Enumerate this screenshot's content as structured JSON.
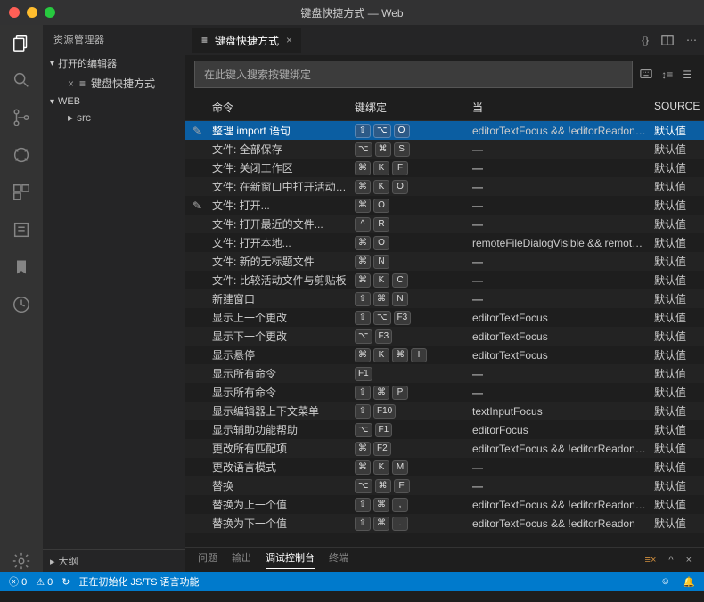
{
  "title": "键盘快捷方式 — Web",
  "sidebar": {
    "title": "资源管理器",
    "open_editors": "打开的编辑器",
    "open_item": "键盘快捷方式",
    "workspace": "WEB",
    "tree": [
      "src"
    ],
    "outline": "大纲"
  },
  "tab": {
    "icon": "≡",
    "label": "键盘快捷方式"
  },
  "search_placeholder": "在此键入搜索按键绑定",
  "columns": {
    "command": "命令",
    "keybinding": "键绑定",
    "when": "当",
    "source": "SOURCE"
  },
  "rows": [
    {
      "cmd": "整理 import 语句",
      "keys": [
        "⇧",
        "⌥",
        "O"
      ],
      "when": "editorTextFocus && !editorReadon…",
      "src": "默认值",
      "selected": true,
      "pencil": true
    },
    {
      "cmd": "文件: 全部保存",
      "keys": [
        "⌥",
        "⌘",
        "S"
      ],
      "when": "—",
      "src": "默认值"
    },
    {
      "cmd": "文件: 关闭工作区",
      "keys": [
        "⌘",
        "K",
        "F"
      ],
      "when": "—",
      "src": "默认值"
    },
    {
      "cmd": "文件: 在新窗口中打开活动文...",
      "keys": [
        "⌘",
        "K",
        "O"
      ],
      "when": "—",
      "src": "默认值"
    },
    {
      "cmd": "文件: 打开...",
      "keys": [
        "⌘",
        "O"
      ],
      "when": "—",
      "src": "默认值",
      "pencil": true
    },
    {
      "cmd": "文件: 打开最近的文件...",
      "keys": [
        "^",
        "R"
      ],
      "when": "—",
      "src": "默认值"
    },
    {
      "cmd": "文件: 打开本地...",
      "keys": [
        "⌘",
        "O"
      ],
      "when": "remoteFileDialogVisible && remot…",
      "src": "默认值"
    },
    {
      "cmd": "文件: 新的无标题文件",
      "keys": [
        "⌘",
        "N"
      ],
      "when": "—",
      "src": "默认值"
    },
    {
      "cmd": "文件: 比较活动文件与剪贴板",
      "keys": [
        "⌘",
        "K",
        "C"
      ],
      "when": "—",
      "src": "默认值"
    },
    {
      "cmd": "新建窗口",
      "keys": [
        "⇧",
        "⌘",
        "N"
      ],
      "when": "—",
      "src": "默认值"
    },
    {
      "cmd": "显示上一个更改",
      "keys": [
        "⇧",
        "⌥",
        "F3"
      ],
      "when": "editorTextFocus",
      "src": "默认值"
    },
    {
      "cmd": "显示下一个更改",
      "keys": [
        "⌥",
        "F3"
      ],
      "when": "editorTextFocus",
      "src": "默认值"
    },
    {
      "cmd": "显示悬停",
      "keys": [
        "⌘",
        "K",
        "⌘",
        "I"
      ],
      "when": "editorTextFocus",
      "src": "默认值"
    },
    {
      "cmd": "显示所有命令",
      "keys": [
        "F1"
      ],
      "when": "—",
      "src": "默认值"
    },
    {
      "cmd": "显示所有命令",
      "keys": [
        "⇧",
        "⌘",
        "P"
      ],
      "when": "—",
      "src": "默认值"
    },
    {
      "cmd": "显示编辑器上下文菜单",
      "keys": [
        "⇧",
        "F10"
      ],
      "when": "textInputFocus",
      "src": "默认值"
    },
    {
      "cmd": "显示辅助功能帮助",
      "keys": [
        "⌥",
        "F1"
      ],
      "when": "editorFocus",
      "src": "默认值"
    },
    {
      "cmd": "更改所有匹配项",
      "keys": [
        "⌘",
        "F2"
      ],
      "when": "editorTextFocus && !editorReadon…",
      "src": "默认值"
    },
    {
      "cmd": "更改语言模式",
      "keys": [
        "⌘",
        "K",
        "M"
      ],
      "when": "—",
      "src": "默认值"
    },
    {
      "cmd": "替换",
      "keys": [
        "⌥",
        "⌘",
        "F"
      ],
      "when": "—",
      "src": "默认值"
    },
    {
      "cmd": "替换为上一个值",
      "keys": [
        "⇧",
        "⌘",
        ","
      ],
      "when": "editorTextFocus && !editorReadon…",
      "src": "默认值"
    },
    {
      "cmd": "替换为下一个值",
      "keys": [
        "⇧",
        "⌘",
        "."
      ],
      "when": "editorTextFocus && !editorReadon",
      "src": "默认值"
    }
  ],
  "panel": {
    "tabs": [
      "问题",
      "输出",
      "调试控制台",
      "终端"
    ],
    "active": 2
  },
  "status": {
    "errors": "0",
    "warnings": "0",
    "msg": "正在初始化 JS/TS 语言功能",
    "spin": "↻"
  }
}
